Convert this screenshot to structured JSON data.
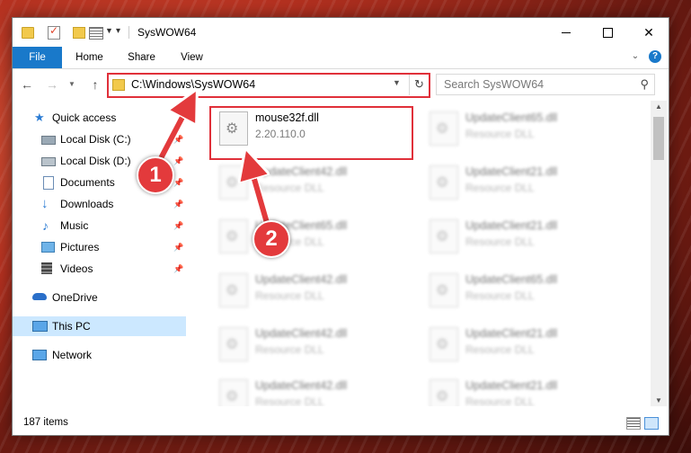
{
  "window": {
    "title": "SysWOW64"
  },
  "ribbon": {
    "file": "File",
    "home": "Home",
    "share": "Share",
    "view": "View",
    "help": "?"
  },
  "address": {
    "path": "C:\\Windows\\SysWOW64"
  },
  "search": {
    "placeholder": "Search SysWOW64"
  },
  "sidebar": {
    "items": [
      {
        "label": "Quick access",
        "icon": "star-icon"
      },
      {
        "label": "Local Disk (C:)",
        "icon": "drive-icon",
        "pinned": true
      },
      {
        "label": "Local Disk (D:)",
        "icon": "drive-icon",
        "pinned": true
      },
      {
        "label": "Documents",
        "icon": "documents-icon",
        "pinned": true
      },
      {
        "label": "Downloads",
        "icon": "downloads-icon",
        "pinned": true
      },
      {
        "label": "Music",
        "icon": "music-icon",
        "pinned": true
      },
      {
        "label": "Pictures",
        "icon": "pictures-icon",
        "pinned": true
      },
      {
        "label": "Videos",
        "icon": "videos-icon",
        "pinned": true
      },
      {
        "label": "OneDrive",
        "icon": "onedrive-icon"
      },
      {
        "label": "This PC",
        "icon": "computer-icon",
        "selected": true
      },
      {
        "label": "Network",
        "icon": "network-icon"
      }
    ]
  },
  "files": [
    {
      "name": "mouse32f.dll",
      "detail": "2.20.110.0",
      "blurred": false
    },
    {
      "name": "UpdateClient65.dll",
      "detail": "Resource DLL",
      "blurred": true
    },
    {
      "name": "UpdateClient42.dll",
      "detail": "Resource DLL",
      "blurred": true
    },
    {
      "name": "UpdateClient21.dll",
      "detail": "Resource DLL",
      "blurred": true
    },
    {
      "name": "UpdateClient65.dll",
      "detail": "Resource DLL",
      "blurred": true
    },
    {
      "name": "UpdateClient21.dll",
      "detail": "Resource DLL",
      "blurred": true
    },
    {
      "name": "UpdateClient42.dll",
      "detail": "Resource DLL",
      "blurred": true
    },
    {
      "name": "UpdateClient65.dll",
      "detail": "Resource DLL",
      "blurred": true
    },
    {
      "name": "UpdateClient42.dll",
      "detail": "Resource DLL",
      "blurred": true
    },
    {
      "name": "UpdateClient21.dll",
      "detail": "Resource DLL",
      "blurred": true
    },
    {
      "name": "UpdateClient42.dll",
      "detail": "Resource DLL",
      "blurred": true
    },
    {
      "name": "UpdateClient21.dll",
      "detail": "Resource DLL",
      "blurred": true
    }
  ],
  "status": {
    "items": "187 items"
  },
  "annotations": {
    "step1": "1",
    "step2": "2",
    "color": "#e33a3c"
  }
}
